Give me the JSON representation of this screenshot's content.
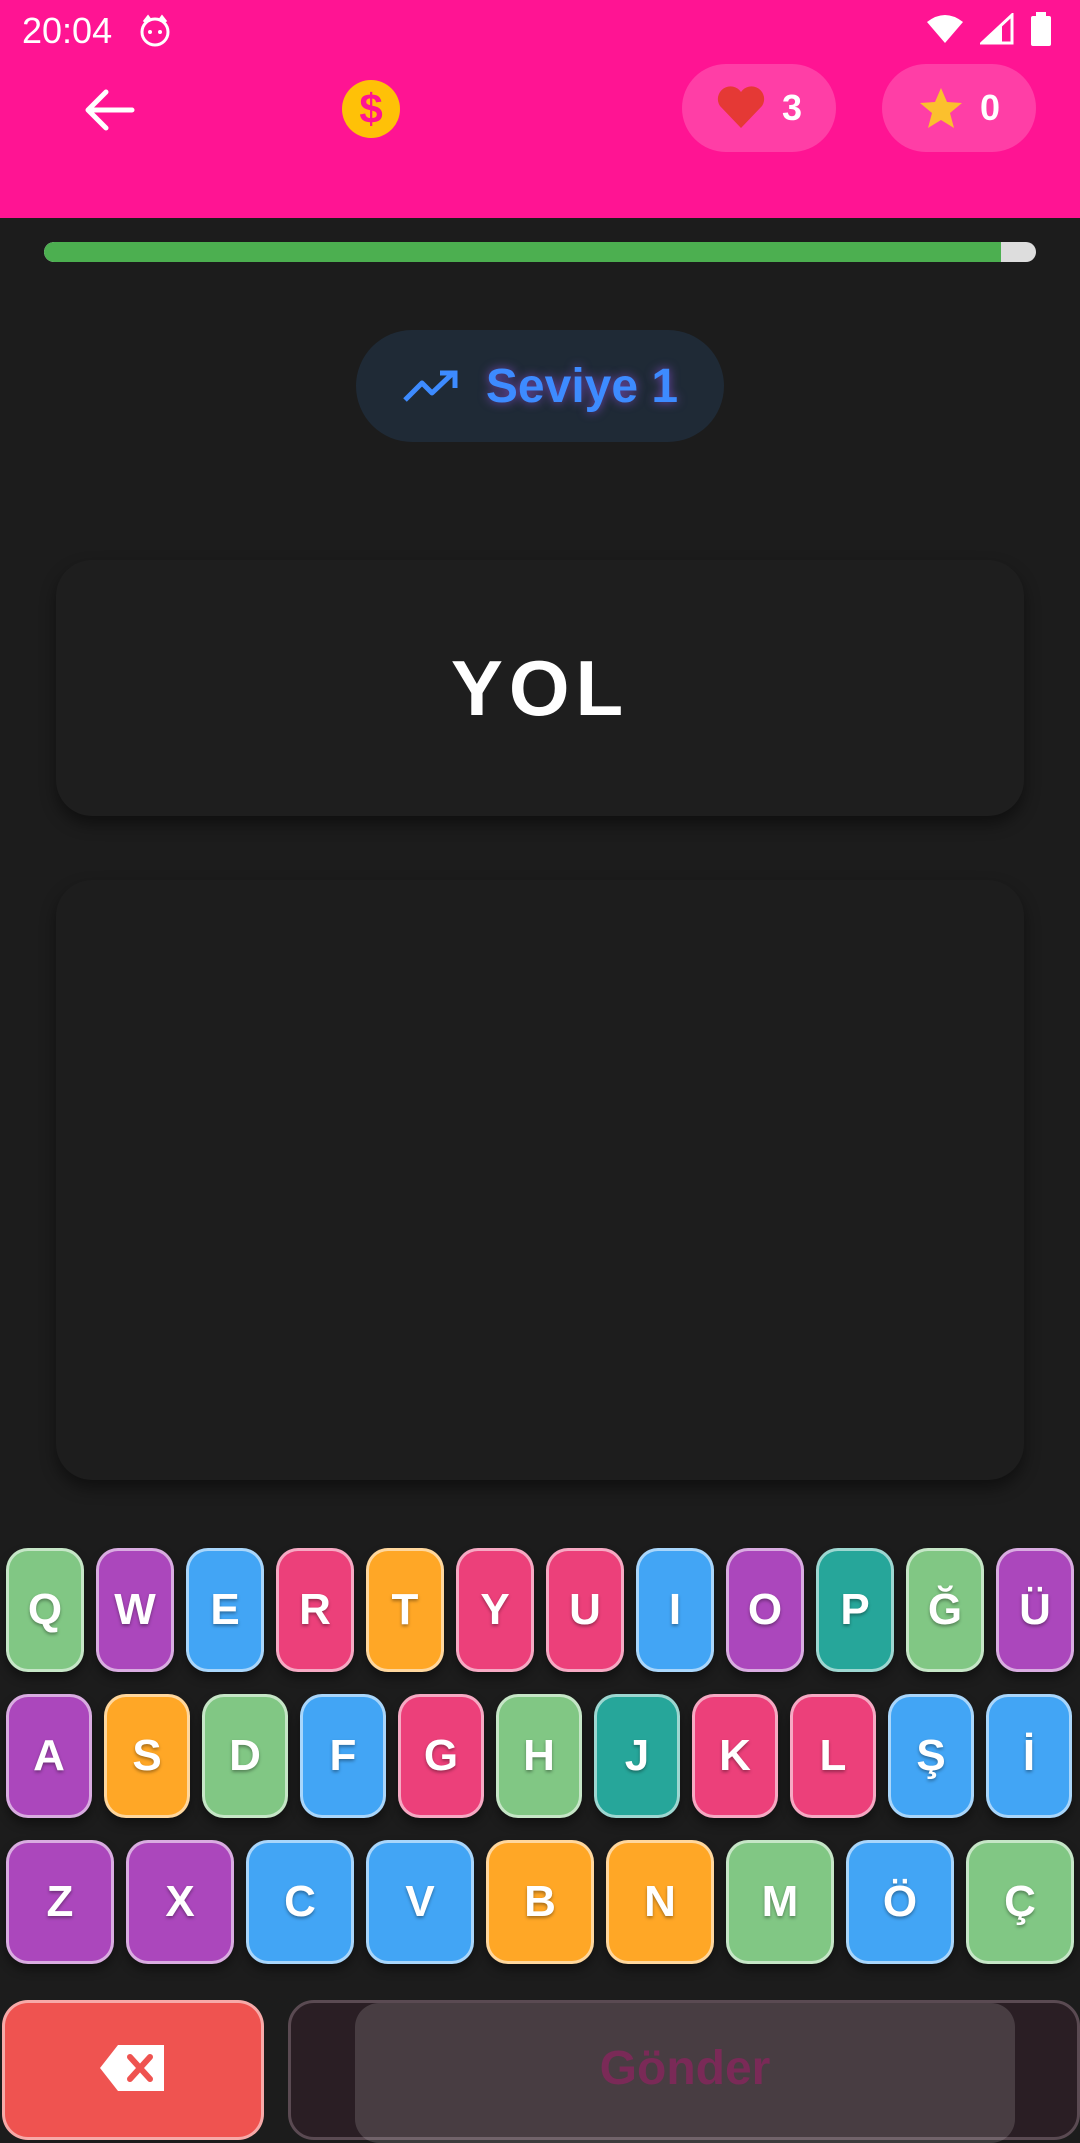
{
  "status_bar": {
    "time": "20:04"
  },
  "header": {
    "lives": "3",
    "stars": "0",
    "coin_symbol": "$",
    "accent_color": "#ff1493"
  },
  "progress": {
    "fraction": 0.965,
    "fill_color": "#4caf50"
  },
  "level": {
    "label": "Seviye 1",
    "icon": "trending-up-icon"
  },
  "word": "YOL",
  "keyboard": {
    "row1": [
      {
        "letter": "Q",
        "color": "#81c784"
      },
      {
        "letter": "W",
        "color": "#ab47bc"
      },
      {
        "letter": "E",
        "color": "#42a5f5"
      },
      {
        "letter": "R",
        "color": "#ec407a"
      },
      {
        "letter": "T",
        "color": "#ffa726"
      },
      {
        "letter": "Y",
        "color": "#ec407a"
      },
      {
        "letter": "U",
        "color": "#ec407a"
      },
      {
        "letter": "I",
        "color": "#42a5f5"
      },
      {
        "letter": "O",
        "color": "#ab47bc"
      },
      {
        "letter": "P",
        "color": "#26a69a"
      },
      {
        "letter": "Ğ",
        "color": "#81c784"
      },
      {
        "letter": "Ü",
        "color": "#ab47bc"
      }
    ],
    "row2": [
      {
        "letter": "A",
        "color": "#ab47bc"
      },
      {
        "letter": "S",
        "color": "#ffa726"
      },
      {
        "letter": "D",
        "color": "#81c784"
      },
      {
        "letter": "F",
        "color": "#42a5f5"
      },
      {
        "letter": "G",
        "color": "#ec407a"
      },
      {
        "letter": "H",
        "color": "#81c784"
      },
      {
        "letter": "J",
        "color": "#26a69a"
      },
      {
        "letter": "K",
        "color": "#ec407a"
      },
      {
        "letter": "L",
        "color": "#ec407a"
      },
      {
        "letter": "Ş",
        "color": "#42a5f5"
      },
      {
        "letter": "İ",
        "color": "#42a5f5"
      }
    ],
    "row3": [
      {
        "letter": "Z",
        "color": "#ab47bc"
      },
      {
        "letter": "X",
        "color": "#ab47bc"
      },
      {
        "letter": "C",
        "color": "#42a5f5"
      },
      {
        "letter": "V",
        "color": "#42a5f5"
      },
      {
        "letter": "B",
        "color": "#ffa726"
      },
      {
        "letter": "N",
        "color": "#ffa726"
      },
      {
        "letter": "M",
        "color": "#81c784"
      },
      {
        "letter": "Ö",
        "color": "#42a5f5"
      },
      {
        "letter": "Ç",
        "color": "#81c784"
      }
    ]
  },
  "actions": {
    "submit_label": "Gönder"
  }
}
